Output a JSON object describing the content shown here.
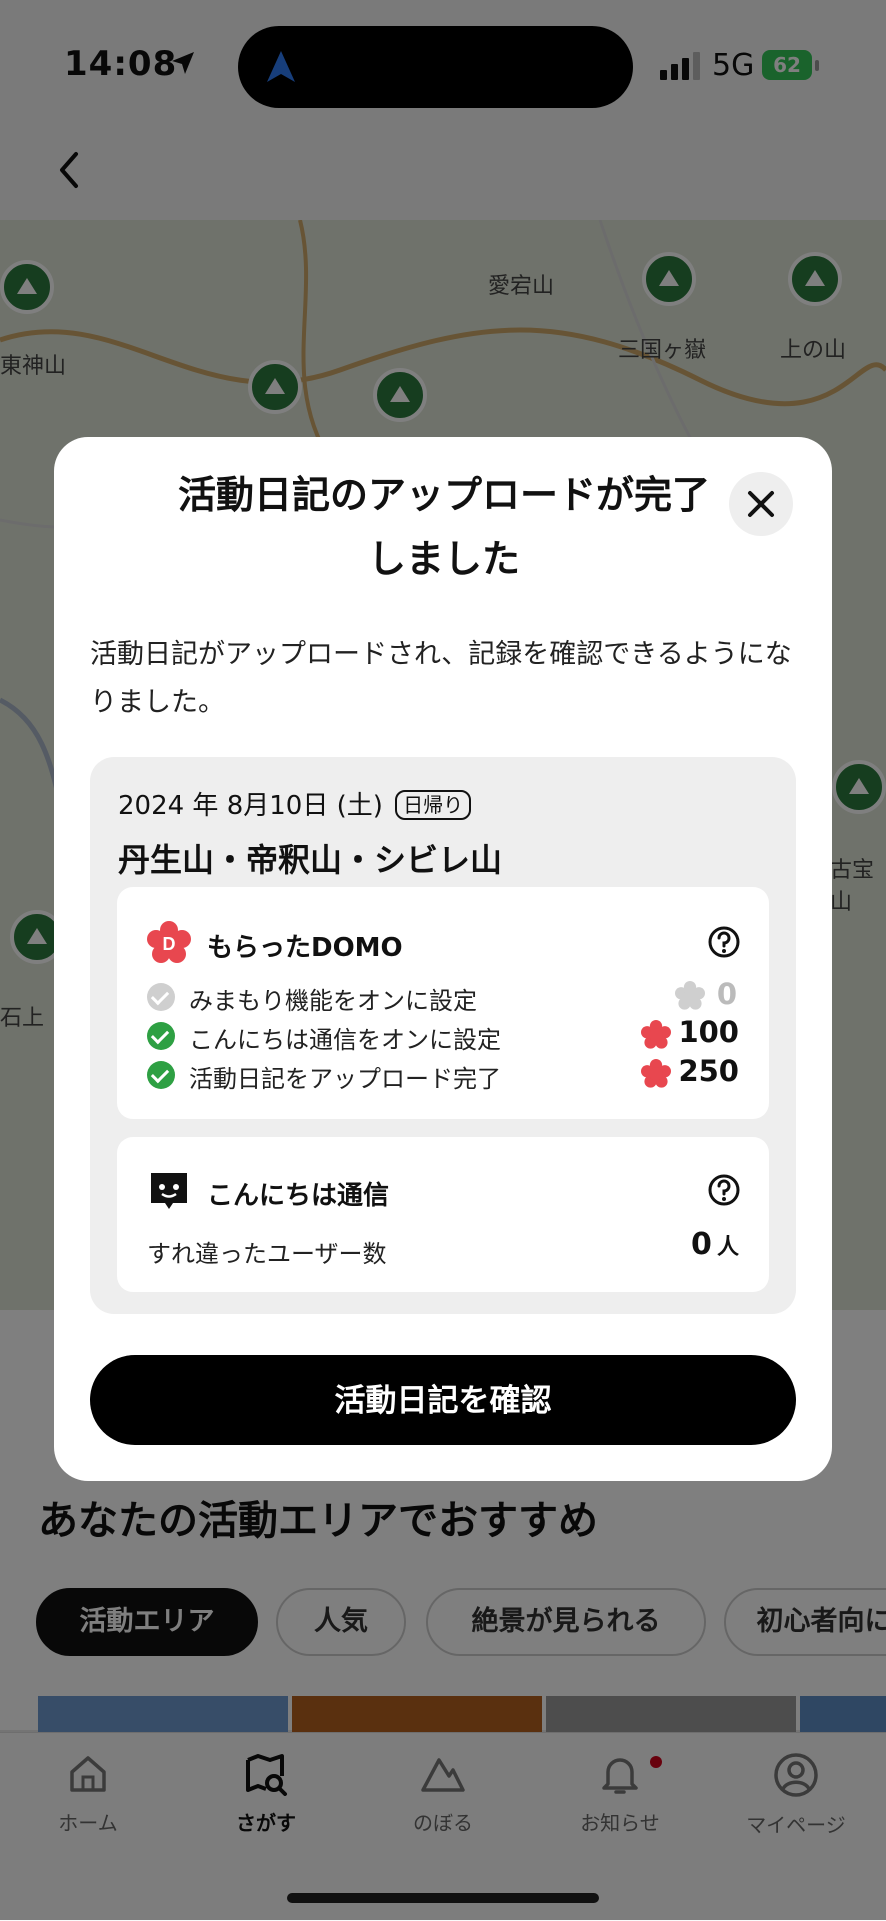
{
  "status_bar": {
    "time": "14:08",
    "network": "5G",
    "battery": "62"
  },
  "map_labels": [
    "愛宕山",
    "三国ヶ嶽",
    "上の山",
    "東神山",
    "古宝山",
    "石上"
  ],
  "recommend": {
    "title": "あなたの活動エリアでおすすめ",
    "chips": [
      "活動エリア",
      "人気",
      "絶景が見られる",
      "初心者向に"
    ]
  },
  "tabs": [
    {
      "label": "ホーム",
      "icon": "home-icon"
    },
    {
      "label": "さがす",
      "icon": "map-search-icon"
    },
    {
      "label": "のぼる",
      "icon": "mountain-icon"
    },
    {
      "label": "お知らせ",
      "icon": "bell-icon"
    },
    {
      "label": "マイページ",
      "icon": "person-icon"
    }
  ],
  "modal": {
    "title_line1": "活動日記のアップロードが完了",
    "title_line2": "しました",
    "description": "活動日記がアップロードされ、記録を確認できるようになりました。",
    "date": "2024 年 8月10日 (土)",
    "trip_type": "日帰り",
    "mountains": "丹生山・帝釈山・シビレ山",
    "domo": {
      "title": "もらったDOMO",
      "rows": [
        {
          "label": "みまもり機能をオンに設定",
          "points": "0",
          "done": false
        },
        {
          "label": "こんにちは通信をオンに設定",
          "points": "100",
          "done": true
        },
        {
          "label": "活動日記をアップロード完了",
          "points": "250",
          "done": true
        }
      ]
    },
    "konnichiwa": {
      "title": "こんにちは通信",
      "passed_label": "すれ違ったユーザー数",
      "passed_count": "0",
      "passed_unit": "人"
    },
    "button": "活動日記を確認"
  },
  "colors": {
    "accent_green": "#2ea043",
    "domo_red": "#e8474f",
    "pin_green": "#2d7a3f"
  }
}
